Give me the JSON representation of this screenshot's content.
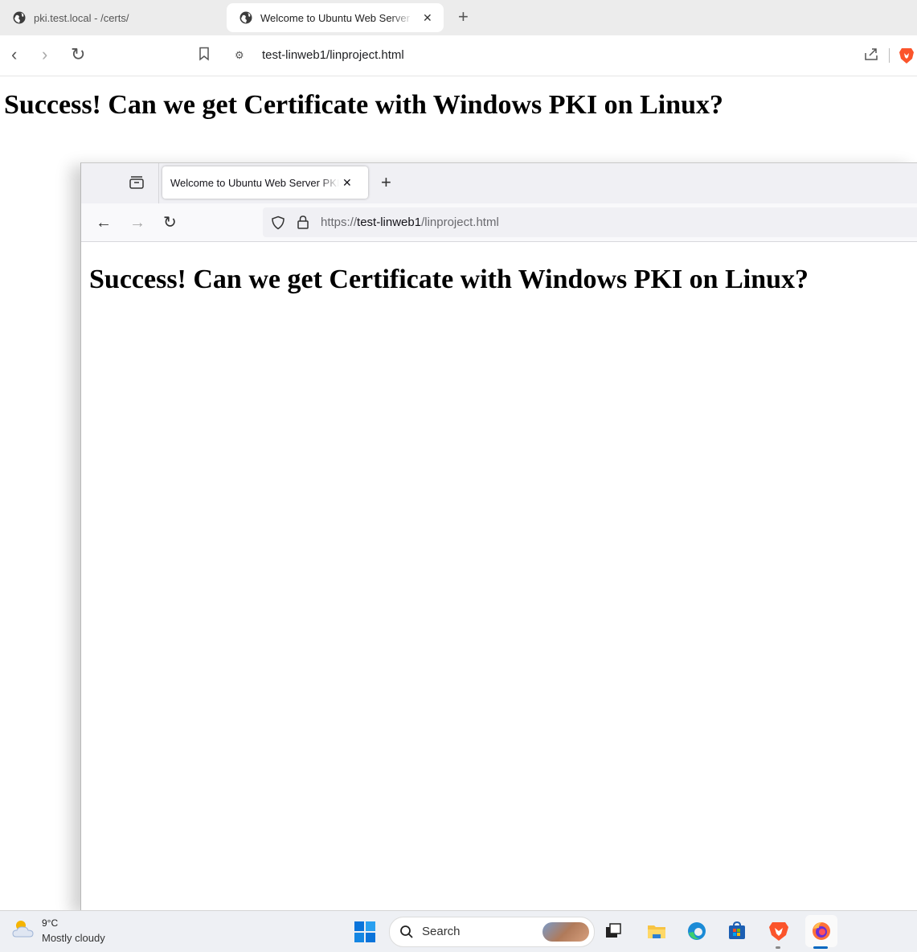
{
  "outer_browser": {
    "tabs": [
      {
        "title": "pki.test.local - /certs/",
        "active": false
      },
      {
        "title": "Welcome to Ubuntu Web Server",
        "active": true
      }
    ],
    "url": "test-linweb1/linproject.html",
    "heading": "Success! Can we get Certificate with Windows PKI on Linux?",
    "icons": {
      "back": "chevron-left-icon",
      "forward": "chevron-right-icon",
      "reload": "reload-icon",
      "bookmark": "bookmark-icon",
      "share": "share-icon",
      "brave": "brave-lion-icon"
    }
  },
  "inner_browser": {
    "tab": {
      "title": "Welcome to Ubuntu Web Server PKI"
    },
    "url_prefix": "https://",
    "url_host": "test-linweb1",
    "url_path": "/linproject.html",
    "heading": "Success! Can we get Certificate with Windows PKI on Linux?"
  },
  "taskbar": {
    "weather": {
      "temp": "9°C",
      "condition": "Mostly cloudy"
    },
    "search_label": "Search",
    "apps": [
      "task-view",
      "file-explorer",
      "edge",
      "microsoft-store",
      "brave",
      "firefox"
    ]
  },
  "colors": {
    "windows_accent": "#0067c0",
    "brave_orange": "#fb542b"
  }
}
